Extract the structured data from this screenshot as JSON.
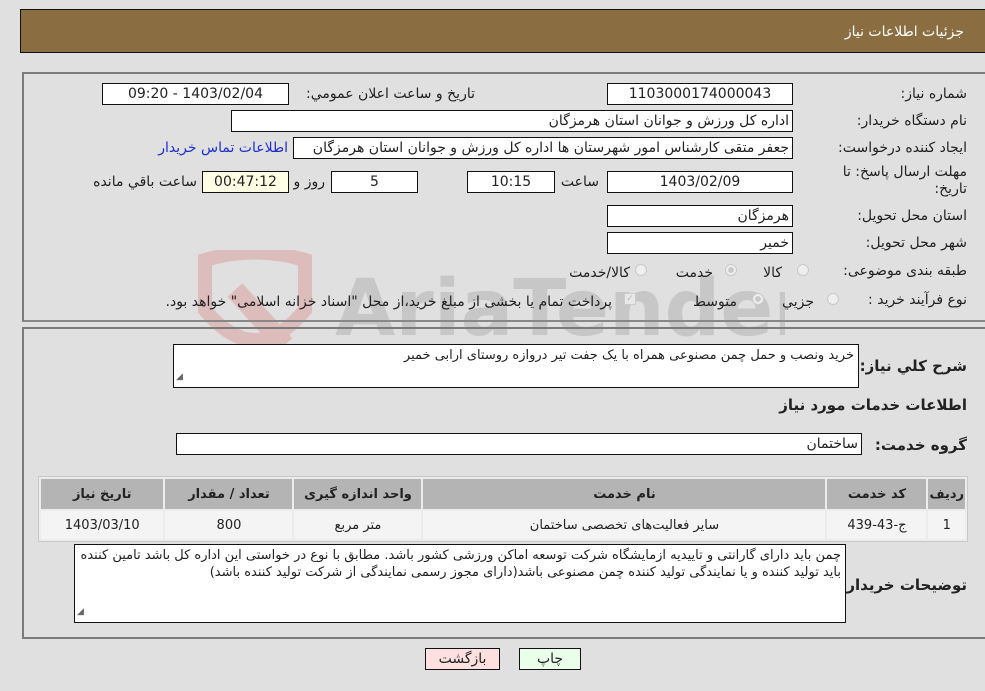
{
  "header": {
    "title": "جزئیات اطلاعات نیاز"
  },
  "form": {
    "need_number": {
      "label": "شماره نیاز:",
      "value": "1103000174000043"
    },
    "announce_datetime": {
      "label": "تاریخ و ساعت اعلان عمومي:",
      "value": "1403/02/04 - 09:20"
    },
    "buyer_org": {
      "label": "نام دستگاه خريدار:",
      "value": "اداره کل ورزش و جوانان استان هرمزگان"
    },
    "requester": {
      "label": "ایجاد کننده درخواست:",
      "value": "جعفر متقی کارشناس امور شهرستان ها اداره کل ورزش و جوانان استان هرمزگان",
      "contact_link": "اطلاعات تماس خریدار"
    },
    "deadline": {
      "label": "مهلت ارسال پاسخ: تا تاریخ:",
      "date": "1403/02/09",
      "time_label": "ساعت",
      "time": "10:15",
      "days": "5",
      "days_label": "روز و",
      "remaining": "00:47:12",
      "remaining_label": "ساعت باقي مانده"
    },
    "province": {
      "label": "استان محل تحویل:",
      "value": "هرمزگان"
    },
    "city": {
      "label": "شهر محل تحویل:",
      "value": "خمیر"
    },
    "category": {
      "label": "طبقه بندی موضوعی:",
      "options": [
        "کالا",
        "خدمت",
        "کالا/خدمت"
      ],
      "selected": "خدمت"
    },
    "process": {
      "label": "نوع فرآیند خرید :",
      "options": [
        "جزيي",
        "متوسط"
      ],
      "selected": "متوسط",
      "treasury_note": "پرداخت تمام یا بخشی از مبلغ خرید،از محل \"اسناد خزانه اسلامی\" خواهد بود.",
      "treasury_checked": true
    }
  },
  "details": {
    "summary_label": "شرح کلي نياز:",
    "summary": "خرید ونصب و حمل چمن مصنوعی همراه با یک جفت تیر دروازه روستای ارابی خمیر",
    "services_title": "اطلاعات خدمات مورد نياز",
    "service_group_label": "گروه خدمت:",
    "service_group": "ساختمان",
    "table": {
      "headers": [
        "رديف",
        "کد خدمت",
        "نام خدمت",
        "واحد اندازه گيری",
        "تعداد / مقدار",
        "تاريخ نياز"
      ],
      "rows": [
        [
          "1",
          "ج-43-439",
          "سایر فعالیت‌های تخصصی ساختمان",
          "متر مربع",
          "800",
          "1403/03/10"
        ]
      ]
    },
    "buyer_notes_label": "توضیحات خریدار:",
    "buyer_notes": "چمن باید دارای گارانتی و تاییدیه ازمایشگاه شرکت توسعه اماکن ورزشی کشور باشد. مطابق با نوع در خواستی این اداره کل باشد تامین کننده باید تولید کننده و یا نمایندگی تولید کننده چمن مصنوعی باشد(دارای مجوز رسمی  نمایندگی از شرکت تولید کننده باشد)"
  },
  "buttons": {
    "print": "چاپ",
    "back": "بازگشت"
  },
  "colors": {
    "header_bg": "#8b6d42",
    "print_bg": "#eaffea",
    "back_bg": "#ffe0e0",
    "link": "#1c2ecf"
  }
}
